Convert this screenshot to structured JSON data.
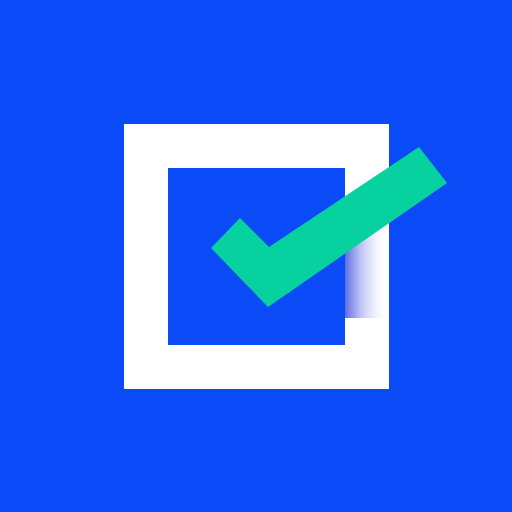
{
  "app_icon": {
    "icon_name": "checked-checkbox-icon",
    "colors": {
      "background": "#0a4bf7",
      "box": "#ffffff",
      "checkmark": "#08d1a0",
      "shadow": "#1b37d9"
    }
  }
}
